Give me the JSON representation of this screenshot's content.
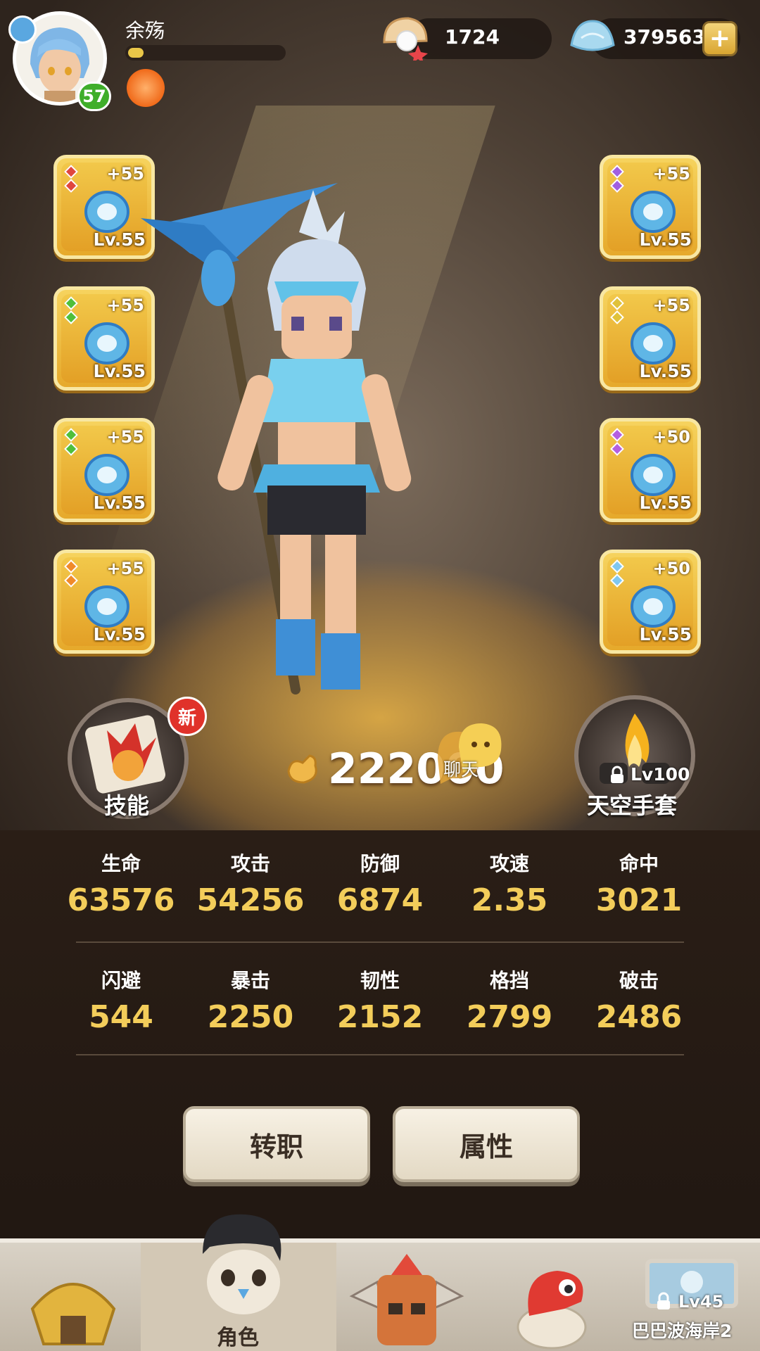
{
  "player": {
    "name": "余殇",
    "level": "57",
    "xp_fraction": 0.1
  },
  "currency": {
    "pearls": "1724",
    "shells": "379563"
  },
  "equipment_left": [
    {
      "name": "staff",
      "plus": "+55",
      "level": "Lv.55",
      "gem_color": "#e0463e"
    },
    {
      "name": "bracelet",
      "plus": "+55",
      "level": "Lv.55",
      "gem_color": "#4fbf3a"
    },
    {
      "name": "horn",
      "plus": "+55",
      "level": "Lv.55",
      "gem_color": "#4fbf3a"
    },
    {
      "name": "ring",
      "plus": "+55",
      "level": "Lv.55",
      "gem_color": "#f08a2a"
    }
  ],
  "equipment_right": [
    {
      "name": "pearl",
      "plus": "+55",
      "level": "Lv.55",
      "gem_color": "#a15fe0"
    },
    {
      "name": "top",
      "plus": "+55",
      "level": "Lv.55",
      "gem_color": "#e0c23a"
    },
    {
      "name": "boots",
      "plus": "+50",
      "level": "Lv.55",
      "gem_color": "#b45fe0"
    },
    {
      "name": "necklace",
      "plus": "+50",
      "level": "Lv.55",
      "gem_color": "#7fc7f0"
    }
  ],
  "skill": {
    "label": "技能",
    "badge": "新"
  },
  "glove": {
    "label": "天空手套",
    "lock_level": "Lv100"
  },
  "power": "222000",
  "chat_label": "聊天",
  "stats_row1": [
    {
      "name": "生命",
      "value": "63576"
    },
    {
      "name": "攻击",
      "value": "54256"
    },
    {
      "name": "防御",
      "value": "6874"
    },
    {
      "name": "攻速",
      "value": "2.35"
    },
    {
      "name": "命中",
      "value": "3021"
    }
  ],
  "stats_row2": [
    {
      "name": "闪避",
      "value": "544"
    },
    {
      "name": "暴击",
      "value": "2250"
    },
    {
      "name": "韧性",
      "value": "2152"
    },
    {
      "name": "格挡",
      "value": "2799"
    },
    {
      "name": "破击",
      "value": "2486"
    }
  ],
  "buttons": {
    "job_change": "转职",
    "attributes": "属性"
  },
  "nav": {
    "active_label": "角色",
    "locked_level": "Lv45",
    "locked_name": "巴巴波海岸2"
  },
  "colors": {
    "accent_gold": "#f3cd5a",
    "slot_gold": "#f6d35e",
    "level_badge": "#3fae2a"
  }
}
